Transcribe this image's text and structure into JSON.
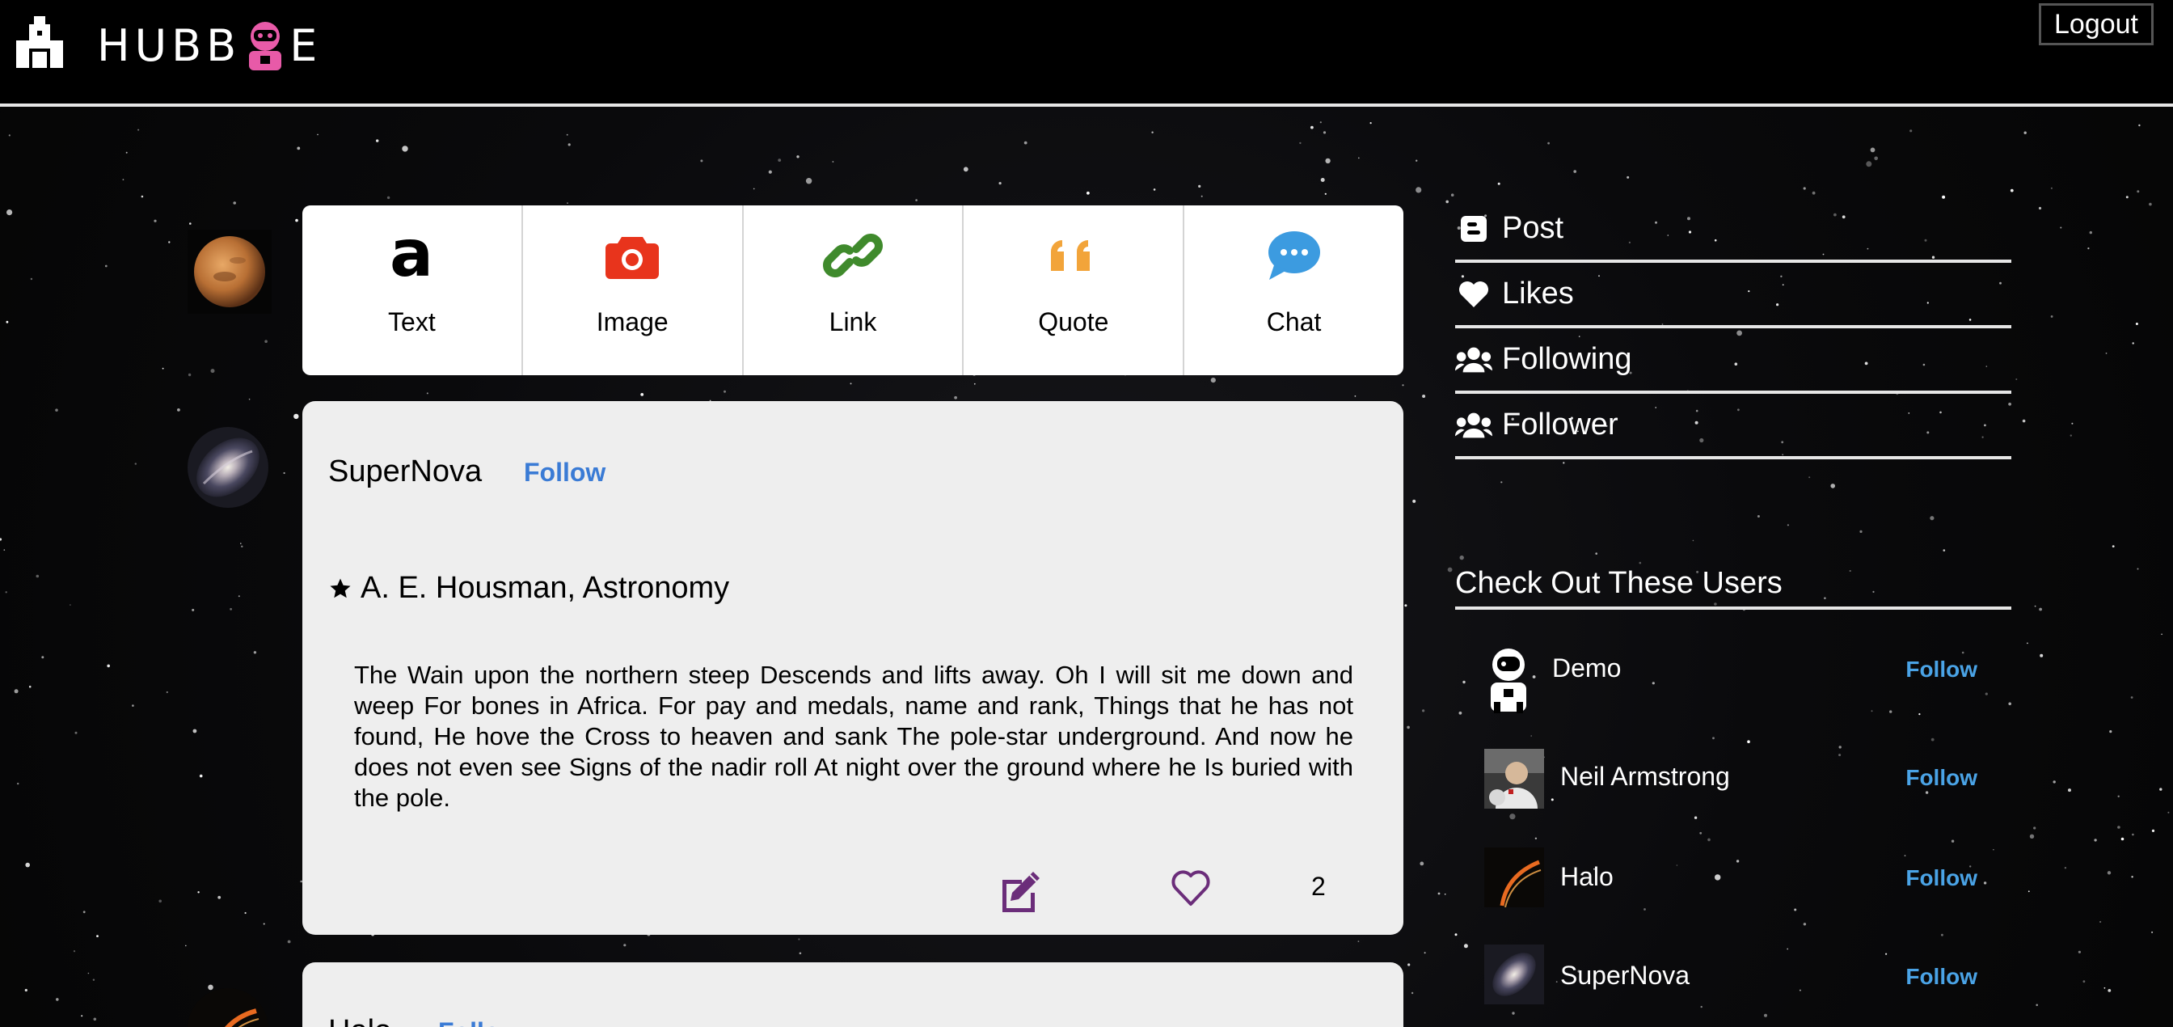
{
  "header": {
    "logo_text_left": "HUBB",
    "logo_text_right": "E",
    "logout_label": "Logout"
  },
  "post_types": [
    {
      "label": "Text",
      "icon": "text-a-icon",
      "color": "#000000"
    },
    {
      "label": "Image",
      "icon": "camera-icon",
      "color": "#e8341c"
    },
    {
      "label": "Link",
      "icon": "link-icon",
      "color": "#3f8a2c"
    },
    {
      "label": "Quote",
      "icon": "quote-icon",
      "color": "#f2a43a"
    },
    {
      "label": "Chat",
      "icon": "chat-bubble-icon",
      "color": "#3c9be0"
    }
  ],
  "post": {
    "author": "SuperNova",
    "follow_label": "Follow",
    "title": "A. E. Housman, Astronomy",
    "body": "The Wain upon the northern steep Descends and lifts away. Oh I will sit me down and weep For bones in Africa. For pay and medals, name and rank, Things that he has not found, He hove the Cross to heaven and sank The pole-star underground. And now he does not even see Signs of the nadir roll At night over the ground where he Is buried with the pole.",
    "like_count": "2"
  },
  "post2": {
    "author": "Halo",
    "follow_label": "Follow"
  },
  "nav": [
    {
      "label": "Post",
      "icon": "blogger-icon"
    },
    {
      "label": "Likes",
      "icon": "heart-icon"
    },
    {
      "label": "Following",
      "icon": "users-icon"
    },
    {
      "label": "Follower",
      "icon": "users-icon"
    }
  ],
  "suggestions": {
    "title": "Check Out These Users",
    "users": [
      {
        "name": "Demo",
        "follow_label": "Follow"
      },
      {
        "name": "Neil Armstrong",
        "follow_label": "Follow"
      },
      {
        "name": "Halo",
        "follow_label": "Follow"
      },
      {
        "name": "SuperNova",
        "follow_label": "Follow"
      }
    ]
  },
  "colors": {
    "accent_follow": "#3a7bd5",
    "sidebar_follow": "#4aa3e6",
    "logo_pink": "#e85aa8",
    "action_purple": "#6b2d7a"
  }
}
